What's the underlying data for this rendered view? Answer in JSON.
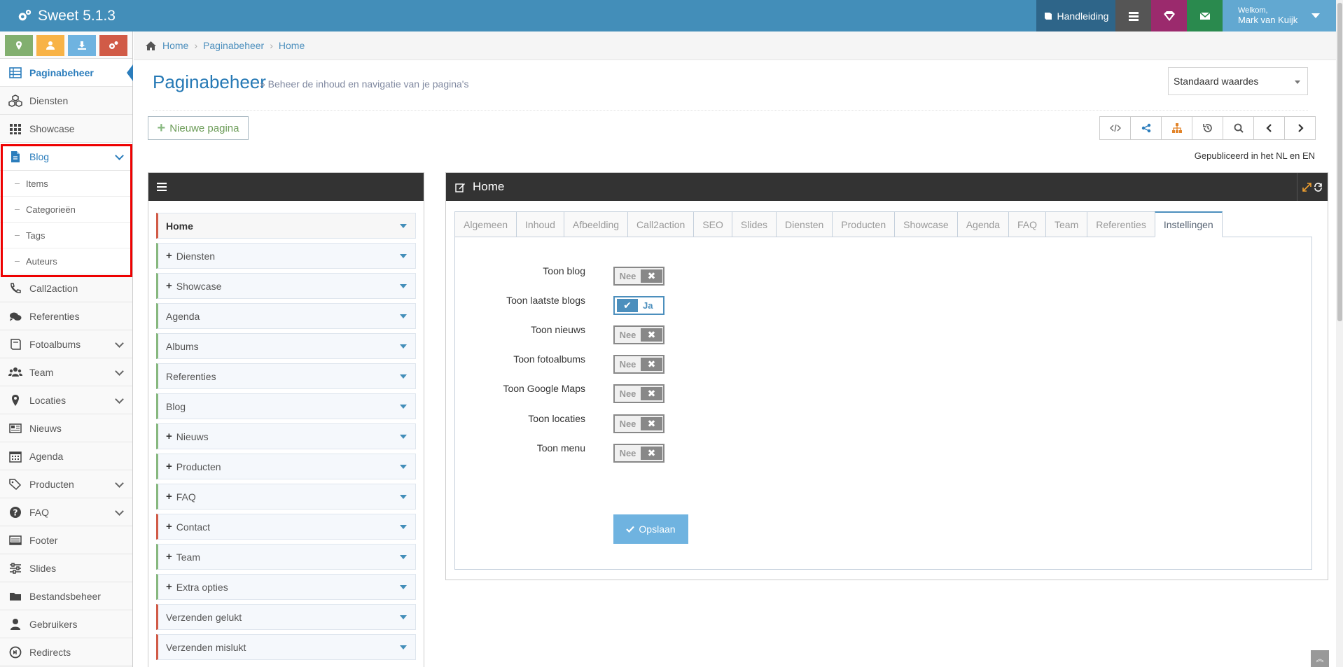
{
  "app": {
    "title": "Sweet 5.1.3"
  },
  "topbar": {
    "manual_label": "Handleiding",
    "welcome": "Welkom,",
    "username": "Mark van Kuijk"
  },
  "sidebar": {
    "shortcut_icons": [
      "map-marker-icon",
      "user-icon",
      "download-icon",
      "cogs-icon"
    ],
    "items": [
      {
        "label": "Paginabeheer",
        "icon": "table-icon"
      },
      {
        "label": "Diensten",
        "icon": "cubes-icon"
      },
      {
        "label": "Showcase",
        "icon": "grid-icon"
      },
      {
        "label": "Blog",
        "icon": "file-icon"
      },
      {
        "label": "Call2action",
        "icon": "phone-icon"
      },
      {
        "label": "Referenties",
        "icon": "comments-icon"
      },
      {
        "label": "Fotoalbums",
        "icon": "book-icon"
      },
      {
        "label": "Team",
        "icon": "users-icon"
      },
      {
        "label": "Locaties",
        "icon": "map-marker-icon"
      },
      {
        "label": "Nieuws",
        "icon": "newspaper-icon"
      },
      {
        "label": "Agenda",
        "icon": "calendar-icon"
      },
      {
        "label": "Producten",
        "icon": "tags-icon"
      },
      {
        "label": "FAQ",
        "icon": "question-icon"
      },
      {
        "label": "Footer",
        "icon": "footer-icon"
      },
      {
        "label": "Slides",
        "icon": "sliders-icon"
      },
      {
        "label": "Bestandsbeheer",
        "icon": "folder-icon"
      },
      {
        "label": "Gebruikers",
        "icon": "user-icon"
      },
      {
        "label": "Redirects",
        "icon": "arrow-circle-icon"
      }
    ],
    "blog_sub": [
      "Items",
      "Categorieën",
      "Tags",
      "Auteurs"
    ]
  },
  "breadcrumbs": [
    "Home",
    "Paginabeheer",
    "Home"
  ],
  "page": {
    "title": "Paginabeheer",
    "subtitle": "» Beheer de inhoud en navigatie van je pagina's",
    "select_value": "Standaard waardes",
    "new_page_label": "Nieuwe pagina",
    "published": "Gepubliceerd in het NL en EN"
  },
  "tree": {
    "items": [
      {
        "label": "Home",
        "plus": false,
        "red": true,
        "bold": true
      },
      {
        "label": "Diensten",
        "plus": true,
        "red": false
      },
      {
        "label": "Showcase",
        "plus": true,
        "red": false
      },
      {
        "label": "Agenda",
        "plus": false,
        "red": false
      },
      {
        "label": "Albums",
        "plus": false,
        "red": false
      },
      {
        "label": "Referenties",
        "plus": false,
        "red": false
      },
      {
        "label": "Blog",
        "plus": false,
        "red": false
      },
      {
        "label": "Nieuws",
        "plus": true,
        "red": false
      },
      {
        "label": "Producten",
        "plus": true,
        "red": false
      },
      {
        "label": "FAQ",
        "plus": true,
        "red": false
      },
      {
        "label": "Contact",
        "plus": true,
        "red": true
      },
      {
        "label": "Team",
        "plus": true,
        "red": false
      },
      {
        "label": "Extra opties",
        "plus": true,
        "red": false
      },
      {
        "label": "Verzenden gelukt",
        "plus": false,
        "red": true
      },
      {
        "label": "Verzenden mislukt",
        "plus": false,
        "red": true
      }
    ]
  },
  "editor": {
    "title": "Home",
    "tabs": [
      "Algemeen",
      "Inhoud",
      "Afbeelding",
      "Call2action",
      "SEO",
      "Slides",
      "Diensten",
      "Producten",
      "Showcase",
      "Agenda",
      "FAQ",
      "Team",
      "Referenties",
      "Instellingen"
    ],
    "active_tab": "Instellingen",
    "settings": [
      {
        "label": "Toon blog",
        "state": "Nee",
        "on": false
      },
      {
        "label": "Toon laatste blogs",
        "state": "Ja",
        "on": true
      },
      {
        "label": "Toon nieuws",
        "state": "Nee",
        "on": false
      },
      {
        "label": "Toon fotoalbums",
        "state": "Nee",
        "on": false
      },
      {
        "label": "Toon Google Maps",
        "state": "Nee",
        "on": false
      },
      {
        "label": "Toon locaties",
        "state": "Nee",
        "on": false
      },
      {
        "label": "Toon menu",
        "state": "Nee",
        "on": false
      }
    ],
    "save_label": "Opslaan"
  },
  "colors": {
    "topbar": "#438eb9",
    "accent": "#2b7dbc",
    "highlight": "#ee0000"
  }
}
